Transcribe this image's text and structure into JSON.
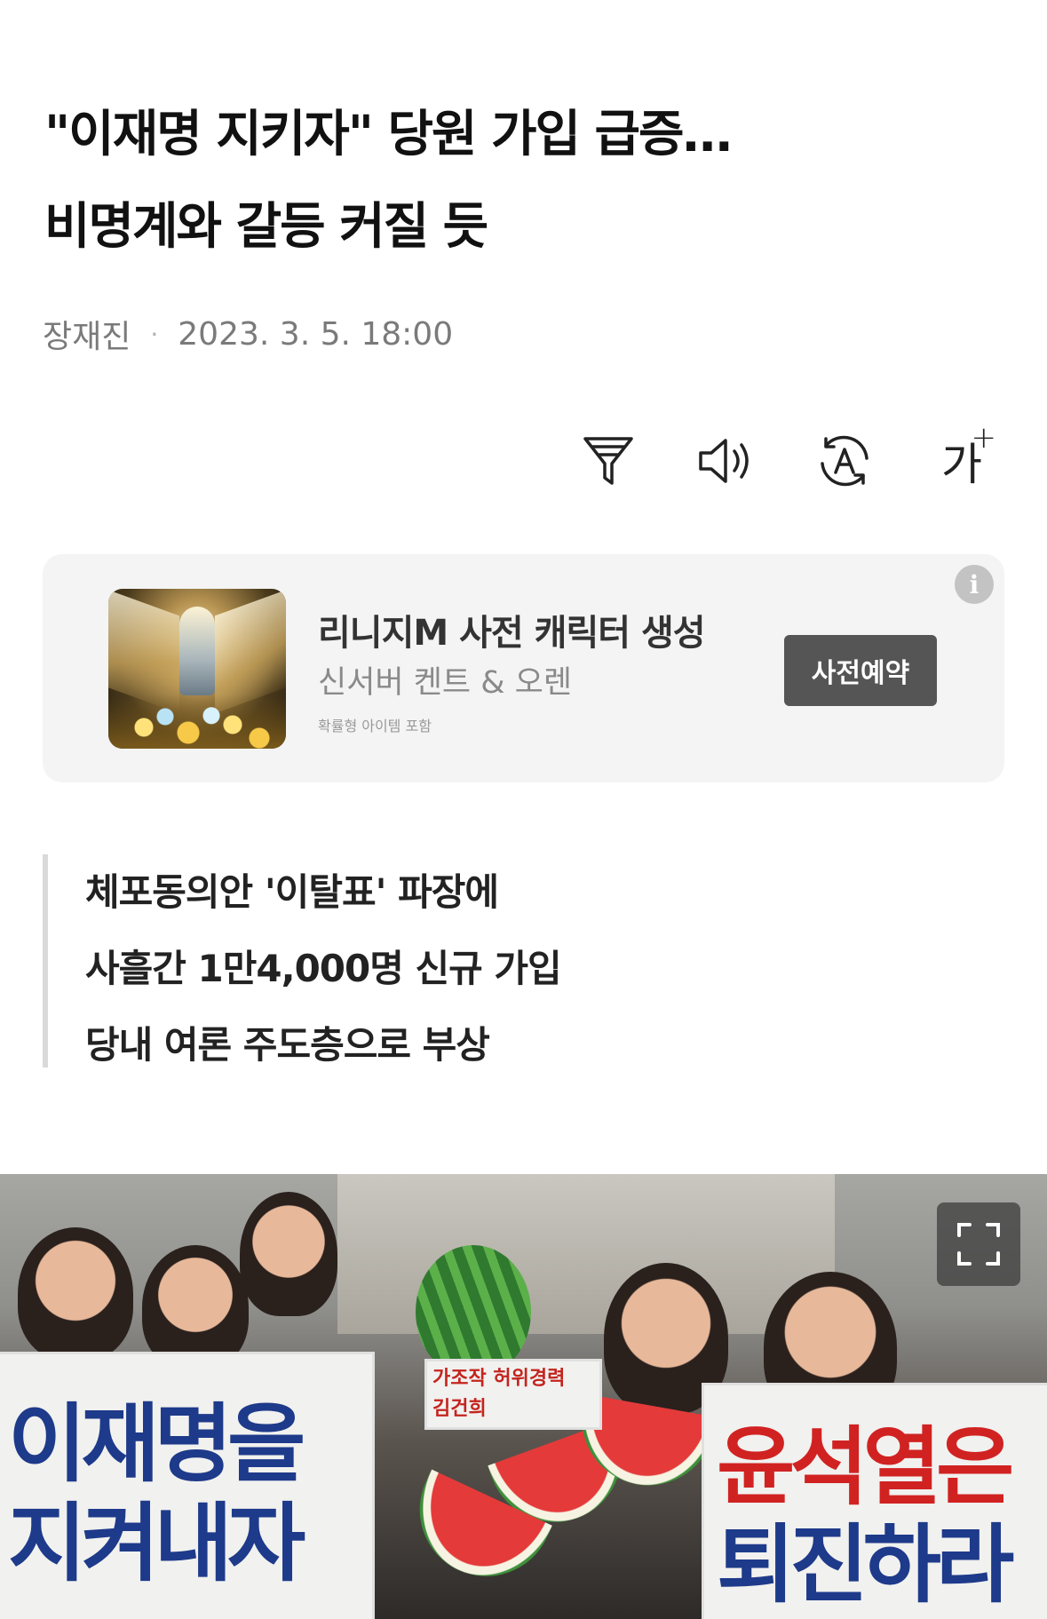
{
  "article": {
    "headline_line1": "\"이재명 지키자\" 당원 가입 급증…",
    "headline_line2": "비명계와 갈등 커질 듯",
    "author": "장재진",
    "datetime": "2023. 3. 5. 18:00"
  },
  "toolbar": {
    "icons": [
      "filter-icon",
      "speaker-icon",
      "translate-icon",
      "font-size-icon"
    ],
    "font_size_glyph": "가",
    "font_size_plus": "+"
  },
  "ad": {
    "title": "리니지M 사전 캐릭터 생성",
    "subtitle": "신서버 켄트 & 오렌",
    "note": "확률형 아이템 포함",
    "button_label": "사전예약",
    "info_glyph": "i"
  },
  "summary": {
    "lines": [
      "체포동의안 '이탈표' 파장에",
      "사흘간 1만4,000명 신규 가입",
      "당내 여론 주도층으로 부상"
    ]
  },
  "photo": {
    "sign_left_line1": "이재명을",
    "sign_left_line2": "지켜내자",
    "sign_mid_line1": "가조작 허위경력",
    "sign_mid_line2": "김건희",
    "sign_right_line1": "윤석열은",
    "sign_right_line2": "퇴진하라"
  }
}
